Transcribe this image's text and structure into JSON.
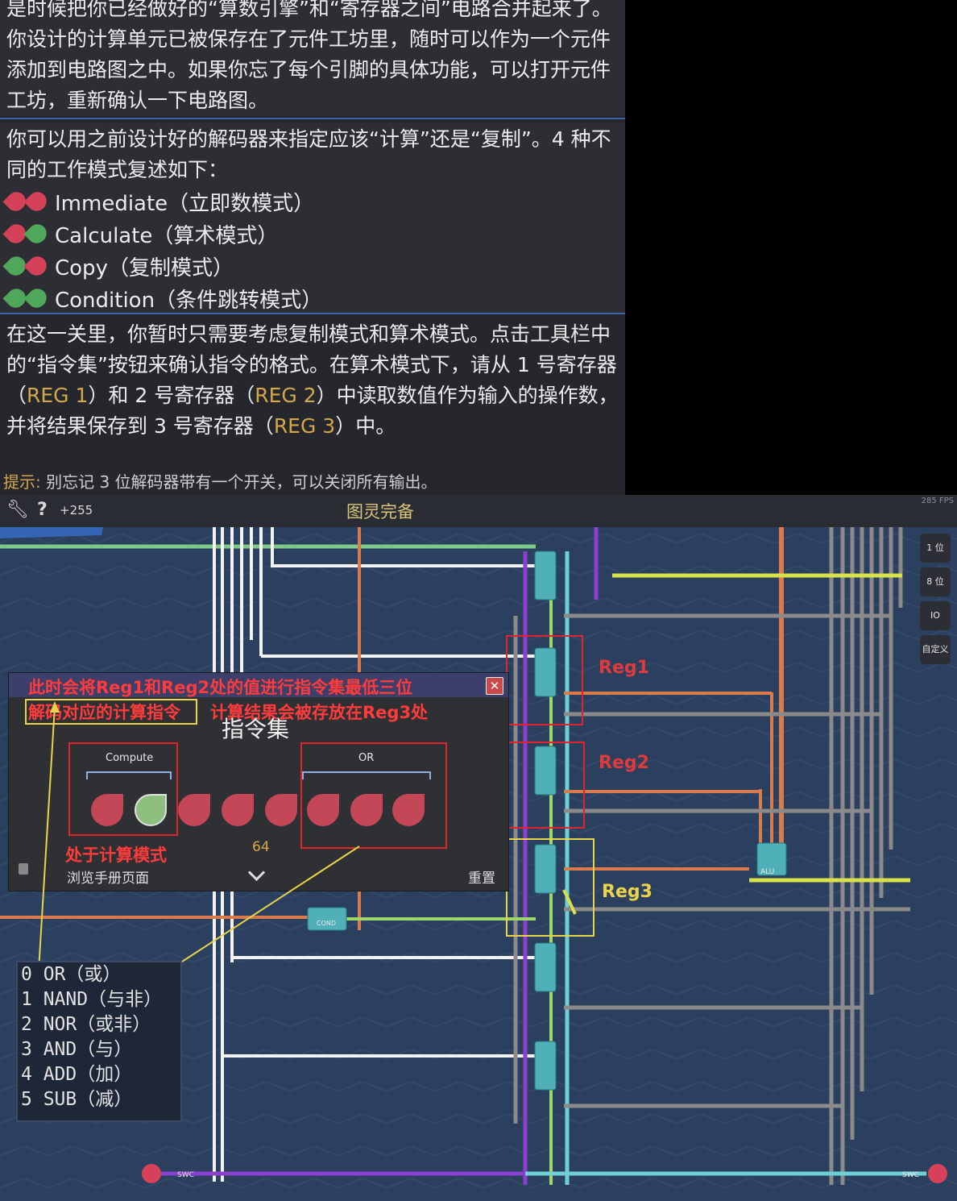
{
  "tutorial": {
    "para1": "是时候把你已经做好的“算数引擎”和“寄存器之间”电路合并起来了。你设计的计算单元已被保存在了元件工坊里，随时可以作为一个元件添加到电路图之中。如果你忘了每个引脚的具体功能，可以打开元件工坊，重新确认一下电路图。",
    "para2": "你可以用之前设计好的解码器来指定应该“计算”还是“复制”。4 种不同的工作模式复述如下：",
    "modes": [
      {
        "label": "Immediate（立即数模式）"
      },
      {
        "label": "Calculate（算术模式）"
      },
      {
        "label": "Copy（复制模式）"
      },
      {
        "label": "Condition（条件跳转模式）"
      }
    ],
    "para3_a": "在这一关里，你暂时只需要考虑复制模式和算术模式。点击工具栏中的“指令集”按钮来确认指令的格式。在算术模式下，请从 1 号寄存器（",
    "reg1": "REG 1",
    "para3_b": "）和 2 号寄存器（",
    "reg2": "REG 2",
    "para3_c": "）中读取数值作为输入的操作数，并将结果保存到 3 号寄存器（",
    "reg3": "REG 3",
    "para3_d": "）中。",
    "hint_label": "提示:",
    "hint_text": " 别忘记 3 位解码器带有一个开关，可以关闭所有输出。"
  },
  "game": {
    "title": "图灵完备",
    "score": "+255",
    "fps": "285 FPS",
    "side_buttons": [
      "1 位",
      "8 位",
      "IO",
      "自定义"
    ],
    "reg_labels": [
      "Reg1",
      "Reg2",
      "Reg3"
    ],
    "comp_labels": {
      "alu": "ALU",
      "swc": "SWC",
      "cond": "COND"
    }
  },
  "dialog": {
    "title": "指令集",
    "note_line1": "此时会将Reg1和Reg2处的值进行指令集最低三位",
    "note_line2a": "解码对应的计算指令",
    "note_line2b": "计算结果会被存放在Reg3处",
    "group_compute": "Compute",
    "group_or": "OR",
    "value": "64",
    "mode_note": "处于计算模式",
    "browse": "浏览手册页面",
    "reset": "重置"
  },
  "ops": [
    "0 OR（或）",
    "1 NAND（与非）",
    "2 NOR（或非）",
    "3 AND（与）",
    "4 ADD（加）",
    "5 SUB（减）"
  ],
  "colors": {
    "accent_red": "#e0252a",
    "accent_yellow": "#e8d34a",
    "wire_purple": "#8a3fd0",
    "wire_cyan": "#6fd0d8",
    "wire_orange": "#d87a4a",
    "wire_grey": "#8a8a8a",
    "wire_green": "#7cc98a",
    "wire_yellow": "#d8e04a"
  }
}
